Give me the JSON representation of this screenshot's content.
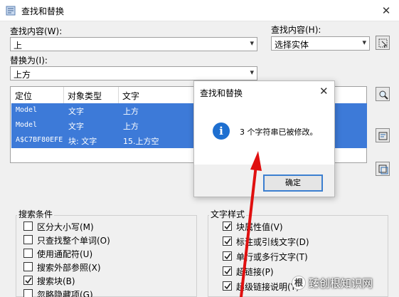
{
  "window": {
    "title": "查找和替换",
    "close_glyph": "✕"
  },
  "find": {
    "label": "查找内容(W):",
    "value": "上"
  },
  "scope": {
    "label": "查找内容(H):",
    "value": "选择实体"
  },
  "replace": {
    "label": "替换为(I):",
    "value": "上方"
  },
  "results": {
    "headers": [
      "定位",
      "对象类型",
      "文字"
    ],
    "rows": [
      {
        "location": "Model",
        "type": "文字",
        "text": "上方"
      },
      {
        "location": "Model",
        "type": "文字",
        "text": "上方"
      },
      {
        "location": "A$C7BF80EFE",
        "type": "块: 文字",
        "text": "15.上方空"
      }
    ]
  },
  "search_conditions": {
    "title": "搜索条件",
    "options": [
      {
        "label": "区分大小写(M)",
        "checked": false
      },
      {
        "label": "只查找整个单词(O)",
        "checked": false
      },
      {
        "label": "使用通配符(U)",
        "checked": false
      },
      {
        "label": "搜索外部参照(X)",
        "checked": false
      },
      {
        "label": "搜索块(B)",
        "checked": true
      },
      {
        "label": "忽略隐藏项(G)",
        "checked": false
      }
    ]
  },
  "text_type": {
    "title": "文字样式",
    "options": [
      {
        "label": "块属性值(V)",
        "checked": true
      },
      {
        "label": "标注或引线文字(D)",
        "checked": true
      },
      {
        "label": "单行或多行文字(T)",
        "checked": true
      },
      {
        "label": "超链接(P)",
        "checked": true
      },
      {
        "label": "超级链接说明(Y)",
        "checked": true
      }
    ]
  },
  "message_box": {
    "title": "查找和替换",
    "close_glyph": "✕",
    "icon_glyph": "i",
    "message": "3 个字符串已被修改。",
    "ok_label": "确定"
  },
  "watermark": {
    "logo_text": "根",
    "text": "臻创根知识网"
  },
  "colors": {
    "selection": "#3d7ad8",
    "info": "#1e6fd0",
    "arrow": "#e01010",
    "focus": "#3c7fd0"
  },
  "icons": [
    "app-icon",
    "close-icon",
    "dropdown-arrow-icon",
    "select-objects-icon",
    "zoom-icon",
    "create-selection-icon",
    "info-icon",
    "arrow-annotation"
  ]
}
